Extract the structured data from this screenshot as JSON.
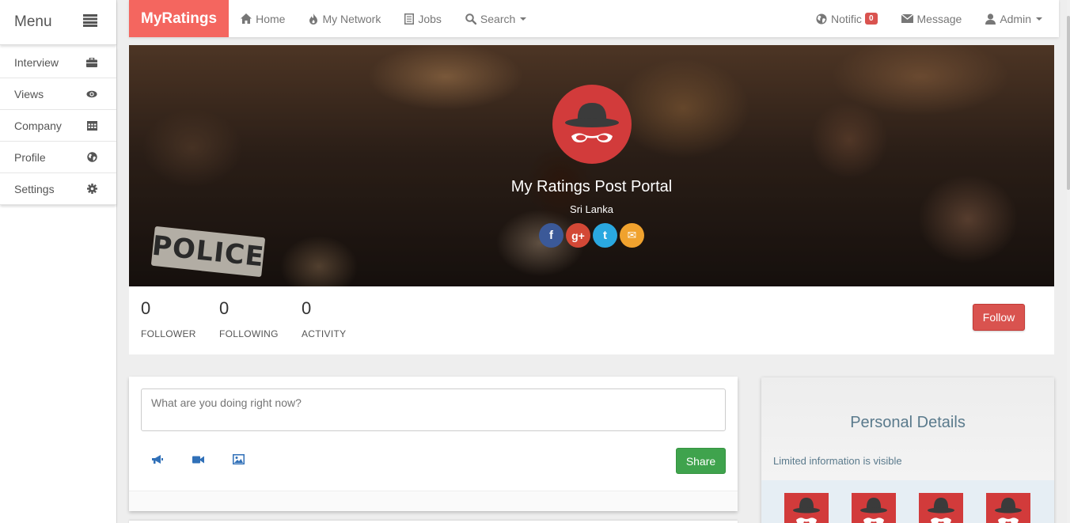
{
  "sidebar": {
    "title": "Menu",
    "items": [
      {
        "label": "Interview",
        "icon": "briefcase-icon"
      },
      {
        "label": "Views",
        "icon": "eye-icon"
      },
      {
        "label": "Company",
        "icon": "calendar-icon"
      },
      {
        "label": "Profile",
        "icon": "globe-icon"
      },
      {
        "label": "Settings",
        "icon": "gear-icon"
      }
    ]
  },
  "nav": {
    "brand": "MyRatings",
    "home": "Home",
    "network": "My Network",
    "jobs": "Jobs",
    "search": "Search",
    "notific": "Notific",
    "notific_count": "0",
    "message": "Message",
    "admin": "Admin"
  },
  "cover": {
    "sign_text": "POLICE",
    "title": "My Ratings Post Portal",
    "location": "Sri Lanka",
    "socials": [
      {
        "icon": "facebook-icon",
        "glyph": "f",
        "color": "#3b5998"
      },
      {
        "icon": "google-plus-icon",
        "glyph": "g+",
        "color": "#d34836"
      },
      {
        "icon": "twitter-icon",
        "glyph": "t",
        "color": "#2aa8e0"
      },
      {
        "icon": "email-icon",
        "glyph": "✉",
        "color": "#f0a22e"
      }
    ]
  },
  "stats": {
    "follower": {
      "value": "0",
      "label": "FOLLOWER"
    },
    "following": {
      "value": "0",
      "label": "FOLLOWING"
    },
    "activity": {
      "value": "0",
      "label": "ACTIVITY"
    },
    "follow_label": "Follow"
  },
  "post": {
    "placeholder": "What are you doing right now?",
    "share_label": "Share"
  },
  "details": {
    "title": "Personal Details",
    "info": "Limited information is visible"
  },
  "colors": {
    "brand": "#f4665f",
    "follow": "#d9534f",
    "share": "#3fa34d",
    "avatar": "#d23b3b"
  }
}
